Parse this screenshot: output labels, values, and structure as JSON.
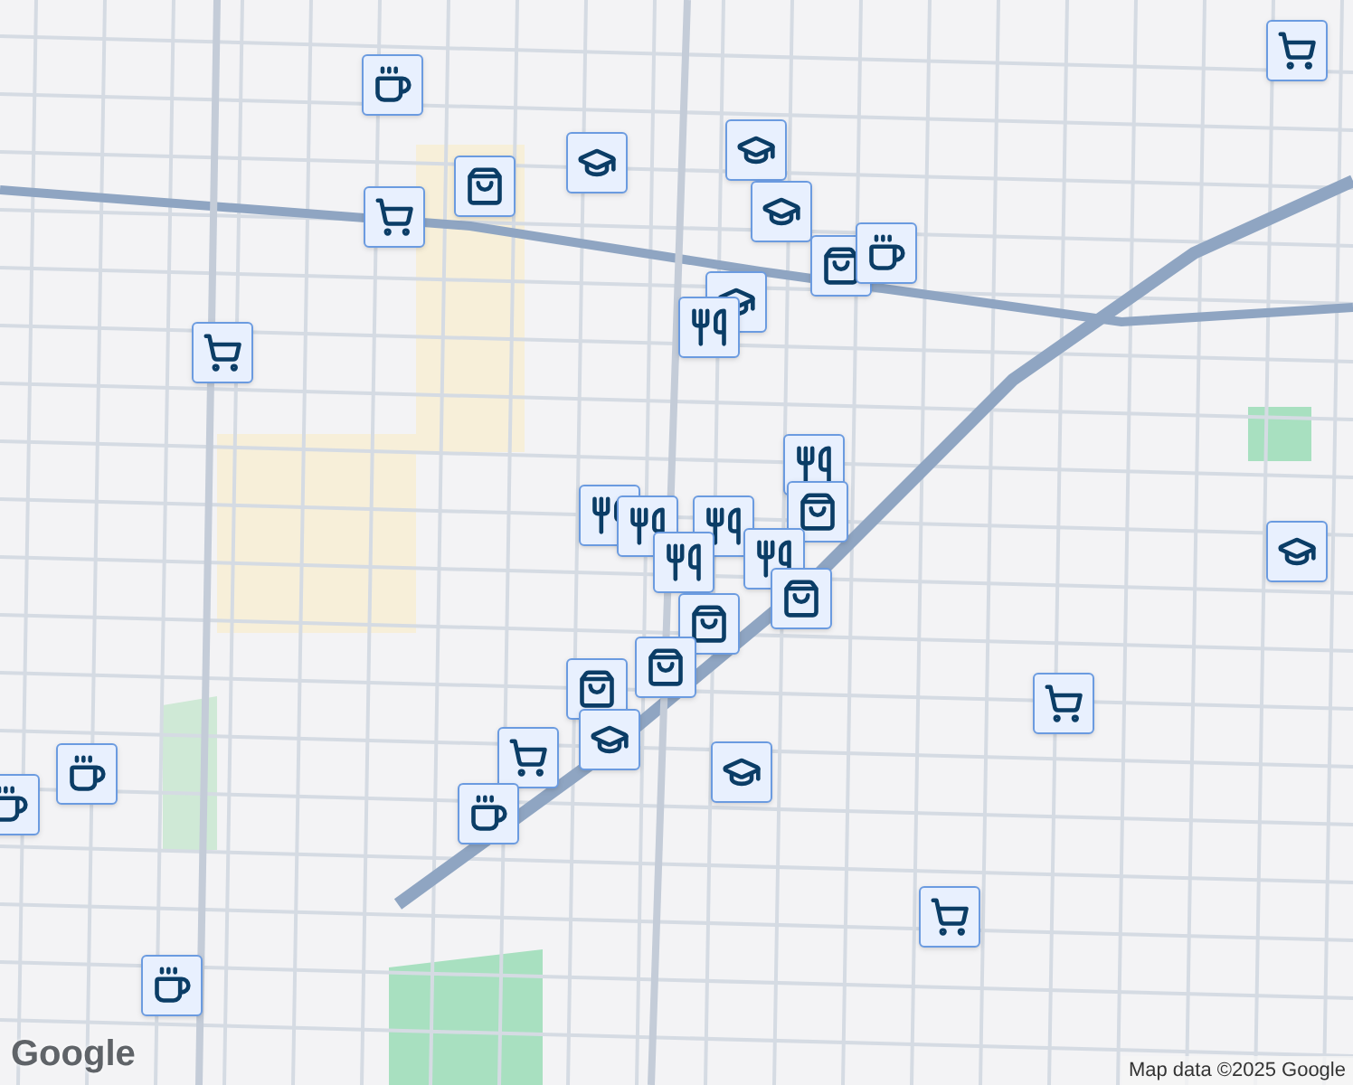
{
  "markers": [
    {
      "kind": "cup"
    },
    {
      "kind": "cart"
    },
    {
      "kind": "school"
    },
    {
      "kind": "school"
    },
    {
      "kind": "school"
    },
    {
      "kind": "bag"
    },
    {
      "kind": "cart"
    },
    {
      "kind": "bag"
    },
    {
      "kind": "cup"
    },
    {
      "kind": "school"
    },
    {
      "kind": "fork"
    },
    {
      "kind": "cart"
    },
    {
      "kind": "fork"
    },
    {
      "kind": "fork"
    },
    {
      "kind": "fork"
    },
    {
      "kind": "bag"
    },
    {
      "kind": "fork"
    },
    {
      "kind": "fork"
    },
    {
      "kind": "fork"
    },
    {
      "kind": "bag"
    },
    {
      "kind": "bag"
    },
    {
      "kind": "bag"
    },
    {
      "kind": "bag"
    },
    {
      "kind": "school"
    },
    {
      "kind": "cart"
    },
    {
      "kind": "cup"
    },
    {
      "kind": "school"
    },
    {
      "kind": "cart"
    },
    {
      "kind": "school"
    },
    {
      "kind": "cup"
    },
    {
      "kind": "cup"
    },
    {
      "kind": "cart"
    },
    {
      "kind": "cup"
    }
  ],
  "logo": "Google",
  "attribution": "Map data ©2025 Google"
}
